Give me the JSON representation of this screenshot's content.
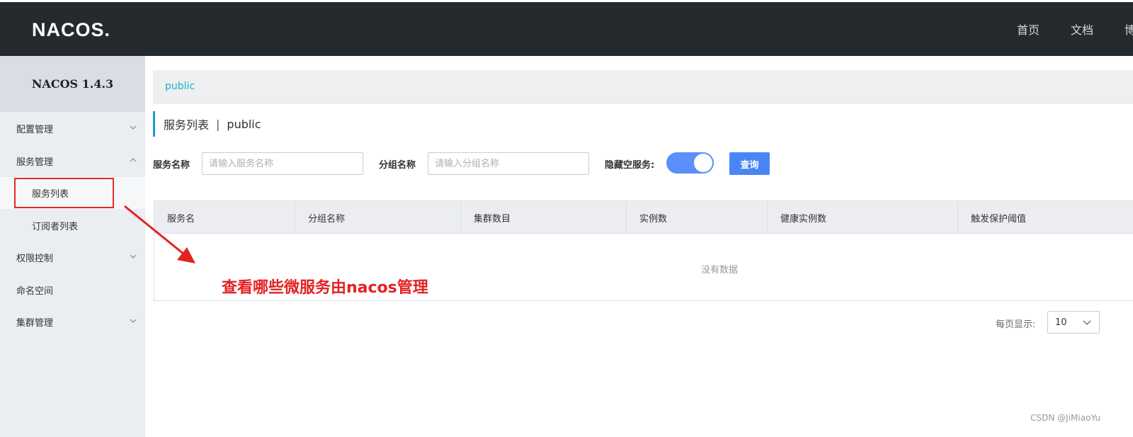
{
  "brand": {
    "logo_text": "NACOS."
  },
  "top_nav": [
    "首页",
    "文档",
    "博客"
  ],
  "sidebar": {
    "version": "NACOS 1.4.3",
    "items": [
      {
        "label": "配置管理",
        "chevron": "down"
      },
      {
        "label": "服务管理",
        "chevron": "up"
      },
      {
        "label": "服务列表",
        "sub": true,
        "active": true
      },
      {
        "label": "订阅者列表",
        "sub": true
      },
      {
        "label": "权限控制",
        "chevron": "down"
      },
      {
        "label": "命名空间"
      },
      {
        "label": "集群管理",
        "chevron": "down"
      }
    ]
  },
  "namespace_tab": "public",
  "page": {
    "title": "服务列表",
    "separator": "|",
    "namespace": "public"
  },
  "filters": {
    "service_name_label": "服务名称",
    "service_name_placeholder": "请输入服务名称",
    "group_name_label": "分组名称",
    "group_name_placeholder": "请输入分组名称",
    "hide_empty_label": "隐藏空服务:",
    "hide_empty_on": true,
    "query_label": "查询"
  },
  "table": {
    "columns": [
      "服务名",
      "分组名称",
      "集群数目",
      "实例数",
      "健康实例数",
      "触发保护阈值"
    ],
    "rows": [],
    "empty_text": "没有数据"
  },
  "annotation": "查看哪些微服务由nacos管理",
  "pagination": {
    "page_size_label": "每页显示:",
    "page_size": "10"
  },
  "watermark": "CSDN @JiMiaoYu",
  "colors": {
    "topbar": "#252a2f",
    "accent": "#1ab1ce",
    "primary": "#4b85f5",
    "annotation": "#e32222"
  }
}
